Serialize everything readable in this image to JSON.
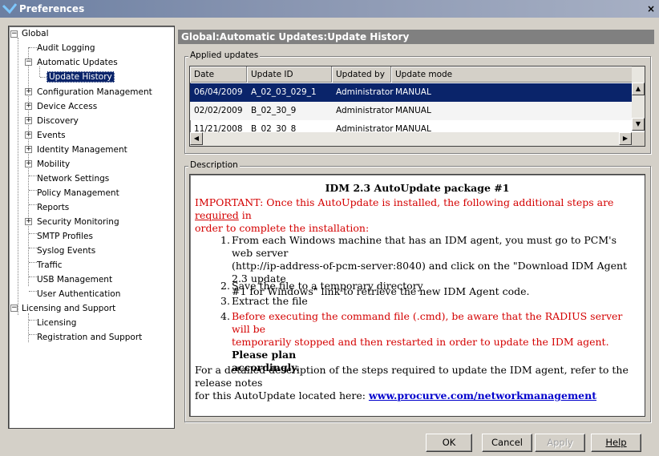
{
  "window": {
    "title": "Preferences",
    "close": "×"
  },
  "tree": {
    "root_global": "Global",
    "audit_logging": "Audit Logging",
    "automatic_updates": "Automatic Updates",
    "update_history": "Update History",
    "configuration_management": "Configuration Management",
    "device_access": "Device Access",
    "discovery": "Discovery",
    "events": "Events",
    "identity_management": "Identity Management",
    "mobility": "Mobility",
    "network_settings": "Network Settings",
    "policy_management": "Policy Management",
    "reports": "Reports",
    "security_monitoring": "Security Monitoring",
    "smtp_profiles": "SMTP Profiles",
    "syslog_events": "Syslog Events",
    "traffic": "Traffic",
    "usb_management": "USB Management",
    "user_authentication": "User Authentication",
    "root_licensing": "Licensing and Support",
    "licensing": "Licensing",
    "registration": "Registration and Support"
  },
  "header": "Global:Automatic Updates:Update History",
  "applied": {
    "legend": "Applied updates",
    "columns": [
      "Date",
      "Update ID",
      "Updated by",
      "Update mode"
    ],
    "rows": [
      [
        "06/04/2009",
        "A_02_03_029_1",
        "Administrator",
        "MANUAL"
      ],
      [
        "02/02/2009",
        "B_02_30_9",
        "Administrator",
        "MANUAL"
      ],
      [
        "11/21/2008",
        "B_02_30_8",
        "Administrator",
        "MANUAL"
      ]
    ]
  },
  "description": {
    "legend": "Description",
    "title": "IDM 2.3 AutoUpdate package #1",
    "important_pre": "IMPORTANT: Once this AutoUpdate is installed, the following additional steps are ",
    "important_req": "required",
    "important_post": " in",
    "important_line2": "order to complete the installation:",
    "step1_l1": "From each Windows machine that has an IDM agent, you must go to PCM's web server",
    "step1_l2": "(http://ip-address-of-pcm-server:8040) and click on the \"Download IDM Agent 2.3 update",
    "step1_l3": "#1 for Windows\" link to retrieve the new IDM Agent code.",
    "step2": "Save the file to a temporary directory",
    "step3": "Extract the file",
    "step4_l1": "Before executing the command file (.cmd), be aware that the RADIUS server will be",
    "step4_l2": "temporarily stopped and then restarted in order to update the IDM agent.",
    "step4_bold1": "Please plan",
    "step4_bold2": "accordingly.",
    "footer_l1": "For a detailed description of the steps required to update the IDM agent, refer to the release notes",
    "footer_l2": "for this AutoUpdate located here: ",
    "footer_link": "www.procurve.com/networkmanagement"
  },
  "buttons": {
    "ok": "OK",
    "cancel": "Cancel",
    "apply": "Apply",
    "help": "Help"
  }
}
